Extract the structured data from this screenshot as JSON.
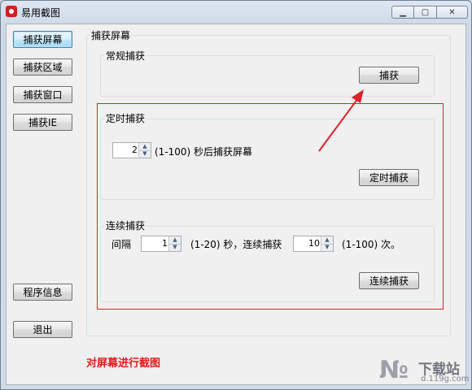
{
  "window": {
    "title": "易用截图",
    "app_icon": "camera-icon",
    "min_glyph": "▁",
    "max_glyph": "▢",
    "close_glyph": "✕"
  },
  "sidebar": {
    "capture_screen": "捕获屏幕",
    "capture_region": "捕获区域",
    "capture_window": "捕获窗口",
    "capture_ie": "捕获IE",
    "program_info": "程序信息",
    "exit": "退出"
  },
  "main": {
    "section_title": "捕获屏幕",
    "normal": {
      "label": "常规捕获",
      "button": "捕获"
    },
    "timed": {
      "label": "定时捕获",
      "value": "2",
      "range_text": "(1-100) 秒后捕获屏幕",
      "button": "定时捕获"
    },
    "continuous": {
      "label": "连续捕获",
      "interval_label": "间隔",
      "interval_value": "1",
      "interval_text": "(1-20) 秒，连续捕获",
      "count_value": "10",
      "count_text": "(1-100) 次。",
      "button": "连续捕获"
    }
  },
  "annotation": {
    "caption": "对屏幕进行截图",
    "color": "#e21b1b"
  },
  "watermark": {
    "logo": "№",
    "site": "下载站",
    "url": "d.119g.com"
  }
}
